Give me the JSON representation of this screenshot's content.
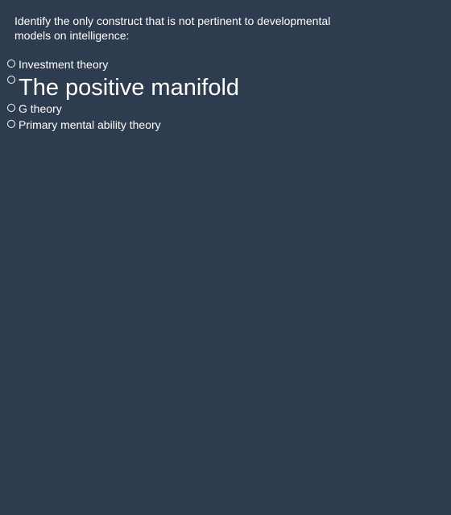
{
  "question": {
    "text": "Identify the only construct that is not pertinent to developmental models on intelligence:"
  },
  "options": [
    {
      "label": "Investment theory",
      "selected": false
    },
    {
      "label": "The positive manifold",
      "selected": false
    },
    {
      "label": "G theory",
      "selected": false
    },
    {
      "label": "Primary mental ability theory",
      "selected": false
    }
  ]
}
